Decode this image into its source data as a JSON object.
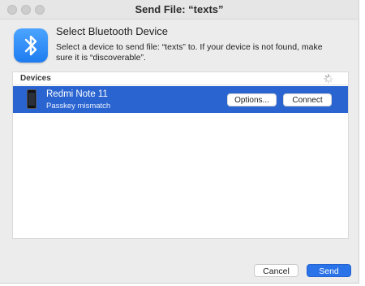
{
  "window": {
    "title": "Send File: “texts”"
  },
  "header": {
    "icon": "bluetooth-icon",
    "title": "Select Bluetooth Device",
    "description": "Select a device to send file: “texts” to. If your device is not found, make sure it is “discoverable”."
  },
  "devices": {
    "label": "Devices",
    "items": [
      {
        "name": "Redmi Note 11",
        "status": "Passkey mismatch",
        "icon": "phone-icon",
        "options_label": "Options...",
        "connect_label": "Connect"
      }
    ]
  },
  "footer": {
    "cancel_label": "Cancel",
    "send_label": "Send"
  },
  "colors": {
    "selection": "#2a64d0",
    "accent": "#2a73e8"
  }
}
